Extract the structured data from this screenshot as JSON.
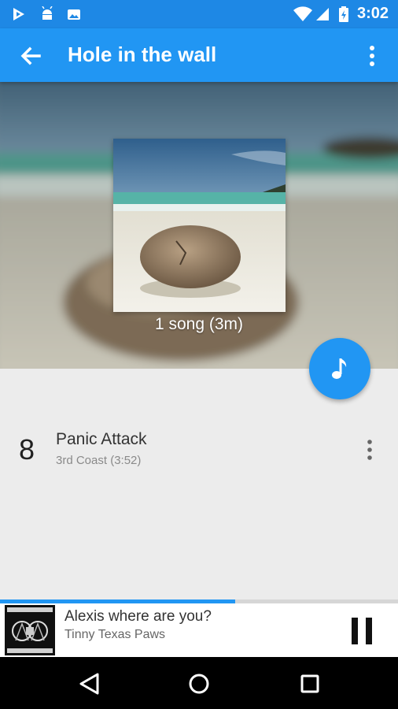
{
  "status_bar": {
    "time": "3:02",
    "left_icons": [
      "play-store-icon",
      "android-debug-icon",
      "photo-notification-icon"
    ],
    "right_icons": [
      "wifi-icon",
      "cell-signal-icon",
      "battery-charging-icon"
    ]
  },
  "app_bar": {
    "title": "Hole in the wall",
    "back_icon": "arrow-back-icon",
    "menu_icon": "more-vert-icon",
    "color": "#2196f3",
    "status_color": "#1e88e5"
  },
  "header": {
    "song_count": "1 song (3m)"
  },
  "fab": {
    "icon": "music-note-icon"
  },
  "tracks": [
    {
      "number": "8",
      "title": "Panic Attack",
      "subtitle": "3rd Coast (3:52)",
      "menu_icon": "more-vert-icon"
    }
  ],
  "now_playing": {
    "title": "Alexis where are you?",
    "artist": "Tinny Texas Paws",
    "progress": 0.59,
    "control_icon": "pause-icon"
  },
  "nav_bar": {
    "icons": [
      "back-triangle-icon",
      "home-circle-icon",
      "recents-square-icon"
    ]
  }
}
